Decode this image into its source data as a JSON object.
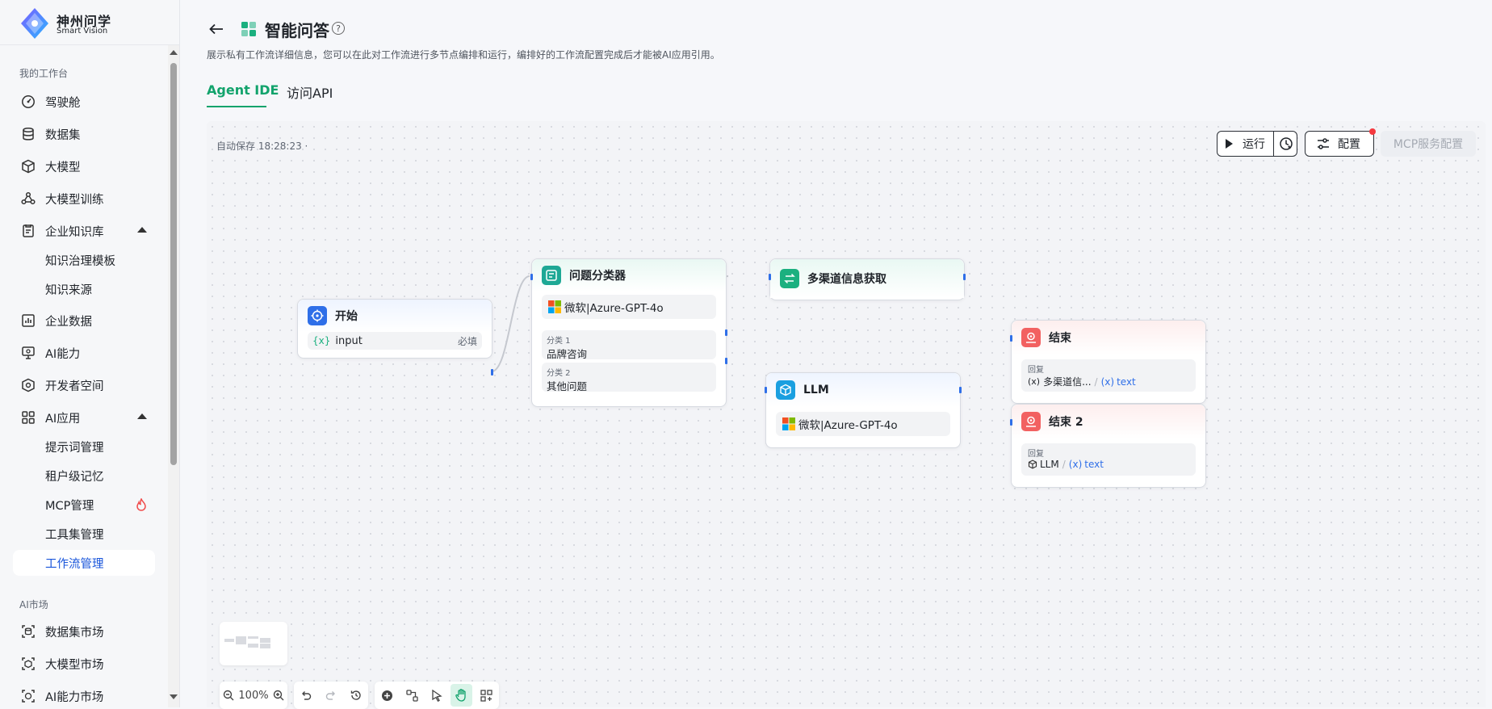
{
  "brand": {
    "name_cn": "神州问学",
    "name_en": "Smart Vision"
  },
  "sidebar": {
    "group_workbench": "我的工作台",
    "items": [
      {
        "label": "驾驶舱",
        "icon": "dashboard-icon"
      },
      {
        "label": "数据集",
        "icon": "database-icon"
      },
      {
        "label": "大模型",
        "icon": "cube-icon"
      },
      {
        "label": "大模型训练",
        "icon": "training-icon"
      },
      {
        "label": "企业知识库",
        "icon": "knowledge-icon"
      },
      {
        "label": "知识治理模板",
        "icon": ""
      },
      {
        "label": "知识来源",
        "icon": ""
      },
      {
        "label": "企业数据",
        "icon": "chart-icon"
      },
      {
        "label": "AI能力",
        "icon": "monitor-icon"
      },
      {
        "label": "开发者空间",
        "icon": "box-icon"
      },
      {
        "label": "AI应用",
        "icon": "apps-icon"
      },
      {
        "label": "提示词管理",
        "icon": ""
      },
      {
        "label": "租户级记忆",
        "icon": ""
      },
      {
        "label": "MCP管理",
        "icon": "fire-icon"
      },
      {
        "label": "工具集管理",
        "icon": ""
      },
      {
        "label": "工作流管理",
        "icon": ""
      }
    ],
    "group_market": "AI市场",
    "market_items": [
      {
        "label": "数据集市场",
        "icon": "dataset-market-icon"
      },
      {
        "label": "大模型市场",
        "icon": "model-market-icon"
      },
      {
        "label": "AI能力市场",
        "icon": "ai-market-icon"
      }
    ],
    "active_item": "工作流管理"
  },
  "header": {
    "title": "智能问答",
    "help": "?",
    "description": "展示私有工作流详细信息，您可以在此对工作流进行多节点编排和运行，编排好的工作流配置完成后才能被AI应用引用。",
    "tabs": [
      {
        "label": "Agent IDE",
        "active": true
      },
      {
        "label": "访问API",
        "active": false
      }
    ]
  },
  "canvas": {
    "autosave": "自动保存 18:28:23 ·",
    "run_label": "运行",
    "config_label": "配置",
    "mcp_label": "MCP服务配置",
    "zoom": "100%"
  },
  "nodes": {
    "start": {
      "title": "开始",
      "var_name": "input",
      "required": "必填"
    },
    "classifier": {
      "title": "问题分类器",
      "model": "微软|Azure-GPT-4o",
      "classes": [
        {
          "label": "分类 1",
          "value": "品牌咨询"
        },
        {
          "label": "分类 2",
          "value": "其他问题"
        }
      ]
    },
    "multi": {
      "title": "多渠道信息获取"
    },
    "llm": {
      "title": "LLM",
      "model": "微软|Azure-GPT-4o"
    },
    "end1": {
      "title": "结束",
      "reply_label": "回复",
      "source": "多渠道信...",
      "slash": "/",
      "var": "text"
    },
    "end2": {
      "title": "结束 2",
      "reply_label": "回复",
      "source": "LLM",
      "slash": "/",
      "var": "text"
    }
  },
  "colors": {
    "accent_green": "#12a36c",
    "active_blue": "#1a56db",
    "port_blue": "#2f6fe8",
    "end_red": "#f26161",
    "teal": "#1bb07f"
  }
}
